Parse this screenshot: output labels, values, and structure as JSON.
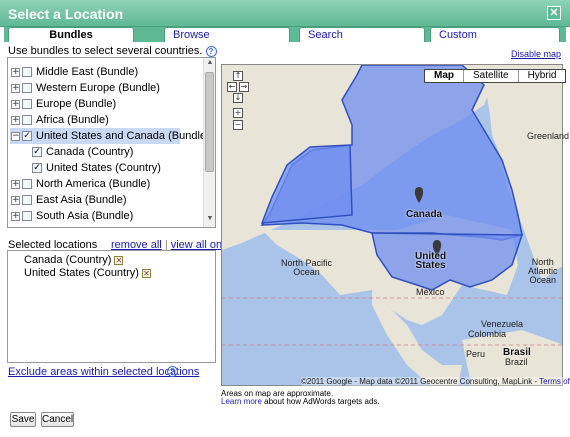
{
  "dialog": {
    "title": "Select a Location",
    "close_glyph": "✕"
  },
  "tabs": [
    {
      "label": "Bundles",
      "active": true
    },
    {
      "label": "Browse",
      "active": false
    },
    {
      "label": "Search",
      "active": false
    },
    {
      "label": "Custom",
      "active": false
    }
  ],
  "hint": "Use bundles to select several countries.",
  "disable_map": "Disable map",
  "bundles": [
    {
      "label": "Middle East (Bundle)",
      "expander": "+",
      "checked": false
    },
    {
      "label": "Western Europe (Bundle)",
      "expander": "+",
      "checked": false
    },
    {
      "label": "Europe (Bundle)",
      "expander": "+",
      "checked": false
    },
    {
      "label": "Africa (Bundle)",
      "expander": "+",
      "checked": false
    },
    {
      "label": "United States and Canada (Bundle)",
      "expander": "−",
      "checked": true,
      "selected": true
    },
    {
      "label": "Canada (Country)",
      "child": true,
      "checked": true
    },
    {
      "label": "United States (Country)",
      "child": true,
      "checked": true
    },
    {
      "label": "North America (Bundle)",
      "expander": "+",
      "checked": false
    },
    {
      "label": "East Asia (Bundle)",
      "expander": "+",
      "checked": false
    },
    {
      "label": "South Asia (Bundle)",
      "expander": "+",
      "checked": false
    }
  ],
  "selected_locations": {
    "heading": "Selected locations",
    "remove_all": "remove all",
    "separator": "|",
    "view_all": "view all on map",
    "items": [
      "Canada (Country)",
      "United States (Country)"
    ]
  },
  "exclude_link": "Exclude areas within selected locations",
  "map": {
    "types": [
      "Map",
      "Satellite",
      "Hybrid"
    ],
    "active_type": "Map",
    "labels": {
      "greenland": "Greenland",
      "canada": "Canada",
      "united_states": "United\nStates",
      "north_pacific": "North Pacific\nOcean",
      "north_atlantic": "North\nAtlantic\nOcean",
      "mexico": "México",
      "venezuela": "Venezuela",
      "colombia": "Colombia",
      "peru": "Peru",
      "brasil": "Brasil",
      "brazil": "Brazil"
    },
    "copyright": "©2011 Google - Map data ©2011 Geocentre Consulting, MapLink -",
    "terms": "Terms of Use",
    "colors": {
      "water": "#a9c4e8",
      "land": "#e8e4d8",
      "highlight": "#6f8ef0"
    }
  },
  "notes": {
    "approx": "Areas on map are approximate.",
    "learn_more": "Learn more",
    "learn_rest": "about how AdWords targets ads."
  },
  "buttons": {
    "save": "Save",
    "cancel": "Cancel"
  }
}
